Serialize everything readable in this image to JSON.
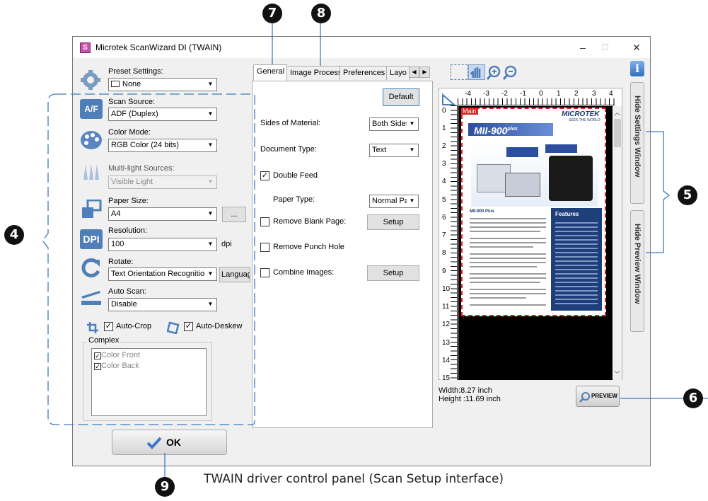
{
  "window": {
    "title": "Microtek ScanWizard DI (TWAIN)",
    "minimize": "–",
    "maximize": "☐",
    "close": "✕"
  },
  "left_panel": {
    "preset": {
      "label": "Preset Settings:",
      "value": "None"
    },
    "scan_source": {
      "label": "Scan Source:",
      "value": "ADF (Duplex)"
    },
    "color_mode": {
      "label": "Color Mode:",
      "value": "RGB Color (24 bits)"
    },
    "multilight": {
      "label": "Multi-light Sources:",
      "value": "Visible Light"
    },
    "paper_size": {
      "label": "Paper Size:",
      "value": "A4",
      "more": "..."
    },
    "resolution": {
      "label": "Resolution:",
      "value": "100",
      "unit": "dpi"
    },
    "rotate": {
      "label": "Rotate:",
      "value": "Text Orientation Recognition",
      "language_button": "Language"
    },
    "auto_scan": {
      "label": "Auto Scan:",
      "value": "Disable"
    },
    "auto_crop": {
      "label": "Auto-Crop",
      "checked": true
    },
    "auto_deskew": {
      "label": "Auto-Deskew",
      "checked": true
    },
    "complex": {
      "label": "Complex",
      "items": [
        "Color Front",
        "Color Back"
      ]
    },
    "ok_button": "OK"
  },
  "tabs": [
    "General",
    "Image Process",
    "Preferences",
    "Layo"
  ],
  "general": {
    "default_button": "Default",
    "sides_label": "Sides of Material:",
    "sides_value": "Both Sides",
    "doctype_label": "Document Type:",
    "doctype_value": "Text",
    "double_feed": "Double Feed",
    "paper_type_label": "Paper Type:",
    "paper_type_value": "Normal Pap",
    "remove_blank": "Remove Blank Page:",
    "setup1": "Setup",
    "remove_punch": "Remove Punch Hole",
    "combine": "Combine Images:",
    "setup2": "Setup"
  },
  "preview": {
    "ruler_top": [
      "-4",
      "-3",
      "-2",
      "-1",
      "0",
      "1",
      "2",
      "3",
      "4"
    ],
    "ruler_left": [
      "0",
      "1",
      "2",
      "3",
      "4",
      "5",
      "6",
      "7",
      "8",
      "9",
      "10",
      "11",
      "12",
      "13",
      "14",
      "15"
    ],
    "main_tag": "Main",
    "doc_brand": "MICROTEK",
    "doc_tagline": "SEEK THE WORLD",
    "doc_model": "MII-900",
    "doc_model_sup": "plus",
    "doc_features": "Features",
    "doc_subtitle": "MII-900 Plus",
    "width": "Width:8.27 inch",
    "height": "Height :11.69 inch",
    "preview_button": "PREVIEW",
    "hide_settings": "Hide Settings Window",
    "hide_preview": "Hide Preview Window",
    "info_icon": "i"
  },
  "callouts": [
    "4",
    "5",
    "6",
    "7",
    "8",
    "9"
  ],
  "caption": "TWAIN driver control panel (Scan Setup interface)"
}
